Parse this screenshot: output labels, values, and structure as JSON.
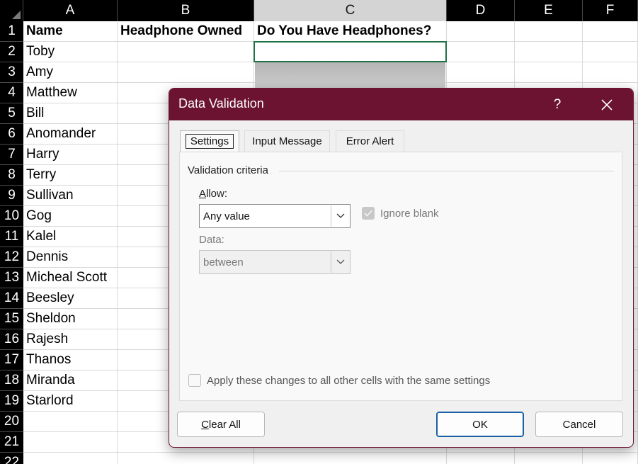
{
  "spreadsheet": {
    "columns": [
      "A",
      "B",
      "C",
      "D",
      "E",
      "F"
    ],
    "selected_column": "C",
    "rows": [
      {
        "num": "1",
        "a": "Name",
        "b": "Headphone Owned",
        "c": "Do You Have Headphones?"
      },
      {
        "num": "2",
        "a": "Toby"
      },
      {
        "num": "3",
        "a": "Amy"
      },
      {
        "num": "4",
        "a": "Matthew"
      },
      {
        "num": "5",
        "a": "Bill"
      },
      {
        "num": "6",
        "a": "Anomander"
      },
      {
        "num": "7",
        "a": "Harry"
      },
      {
        "num": "8",
        "a": "Terry"
      },
      {
        "num": "9",
        "a": "Sullivan"
      },
      {
        "num": "10",
        "a": "Gog"
      },
      {
        "num": "11",
        "a": "Kalel"
      },
      {
        "num": "12",
        "a": "Dennis"
      },
      {
        "num": "13",
        "a": "Micheal Scott"
      },
      {
        "num": "14",
        "a": "Beesley"
      },
      {
        "num": "15",
        "a": "Sheldon"
      },
      {
        "num": "16",
        "a": "Rajesh"
      },
      {
        "num": "17",
        "a": "Thanos"
      },
      {
        "num": "18",
        "a": "Miranda"
      },
      {
        "num": "19",
        "a": "Starlord"
      },
      {
        "num": "20",
        "a": ""
      },
      {
        "num": "21",
        "a": ""
      },
      {
        "num": "22",
        "a": ""
      }
    ]
  },
  "dialog": {
    "title": "Data Validation",
    "help_label": "?",
    "tabs": [
      {
        "label": "Settings",
        "active": true
      },
      {
        "label": "Input Message",
        "active": false
      },
      {
        "label": "Error Alert",
        "active": false
      }
    ],
    "group_label": "Validation criteria",
    "allow": {
      "label_first": "A",
      "label_rest": "llow:",
      "value": "Any value"
    },
    "ignore_blank": {
      "label": "Ignore blank",
      "checked": true,
      "disabled": true
    },
    "data": {
      "label": "Data:",
      "value": "between",
      "disabled": true
    },
    "apply_all": {
      "label": "Apply these changes to all other cells with the same settings",
      "checked": false
    },
    "buttons": {
      "clear_all_first": "C",
      "clear_all_rest": "lear All",
      "ok": "OK",
      "cancel": "Cancel"
    },
    "colors": {
      "titlebar": "#6b1330",
      "default_button_border": "#1b5fa5",
      "selection_border": "#1e7145"
    }
  }
}
